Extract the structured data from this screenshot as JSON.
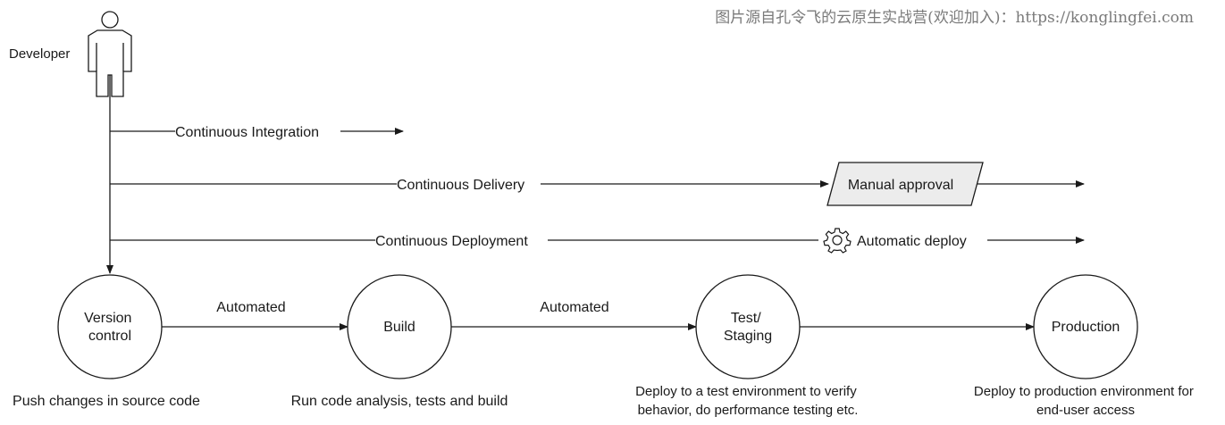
{
  "watermark": "图片源自孔令飞的云原生实战营(欢迎加入)：https://konglingfei.com",
  "actor": {
    "label": "Developer",
    "icon": "person-icon"
  },
  "flows": [
    {
      "id": "ci",
      "label": "Continuous Integration"
    },
    {
      "id": "cdel",
      "label": "Continuous Delivery",
      "gate_label": "Manual approval"
    },
    {
      "id": "cdep",
      "label": "Continuous Deployment",
      "gate_label": "Automatic deploy",
      "gate_icon": "gear-icon"
    }
  ],
  "stages": [
    {
      "id": "vc",
      "label_lines": [
        "Version",
        "control"
      ],
      "desc_lines": [
        "Push changes in source code"
      ]
    },
    {
      "id": "build",
      "label_lines": [
        "Build"
      ],
      "desc_lines": [
        "Run code analysis, tests and build"
      ]
    },
    {
      "id": "test",
      "label_lines": [
        "Test/",
        "Staging"
      ],
      "desc_lines": [
        "Deploy to a test environment to verify",
        "behavior, do performance testing etc."
      ]
    },
    {
      "id": "prod",
      "label_lines": [
        "Production"
      ],
      "desc_lines": [
        "Deploy to production environment for",
        "end-user access"
      ]
    }
  ],
  "transitions": [
    {
      "from": "vc",
      "to": "build",
      "label": "Automated"
    },
    {
      "from": "build",
      "to": "test",
      "label": "Automated"
    },
    {
      "from": "test",
      "to": "prod",
      "label": ""
    }
  ],
  "colors": {
    "line": "#1a1a1a",
    "approval_fill": "#ececec",
    "watermark": "#7a7a7a"
  }
}
